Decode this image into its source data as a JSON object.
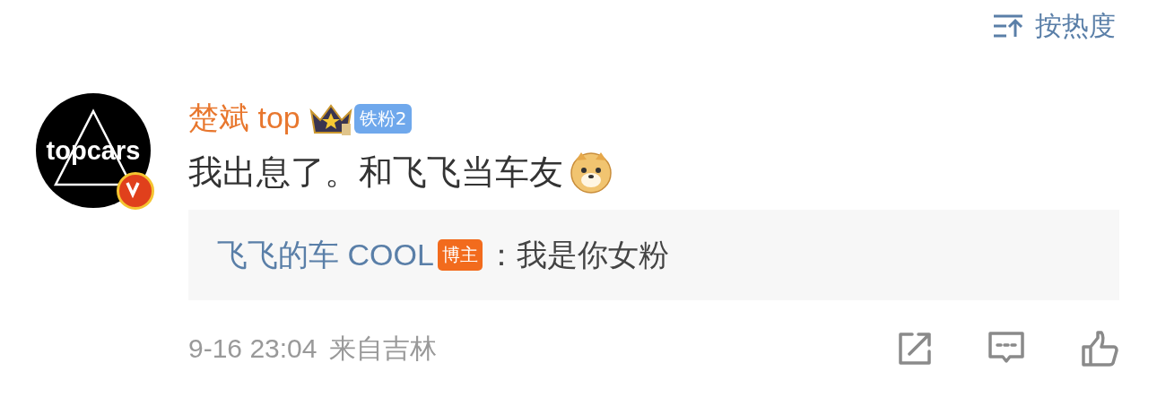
{
  "sort_button": {
    "label": "按热度"
  },
  "comment": {
    "avatar": {
      "logo_text": "topcars",
      "verified": true
    },
    "author": {
      "name": "楚斌 top",
      "fan_badge": "铁粉2"
    },
    "text": "我出息了。和飞飞当车友",
    "reply": {
      "author": "飞飞的车 COOL",
      "author_badge": "博主",
      "separator": "：",
      "text": "我是你女粉"
    },
    "meta": {
      "time": "9-16 23:04",
      "location": "来自吉林"
    }
  }
}
